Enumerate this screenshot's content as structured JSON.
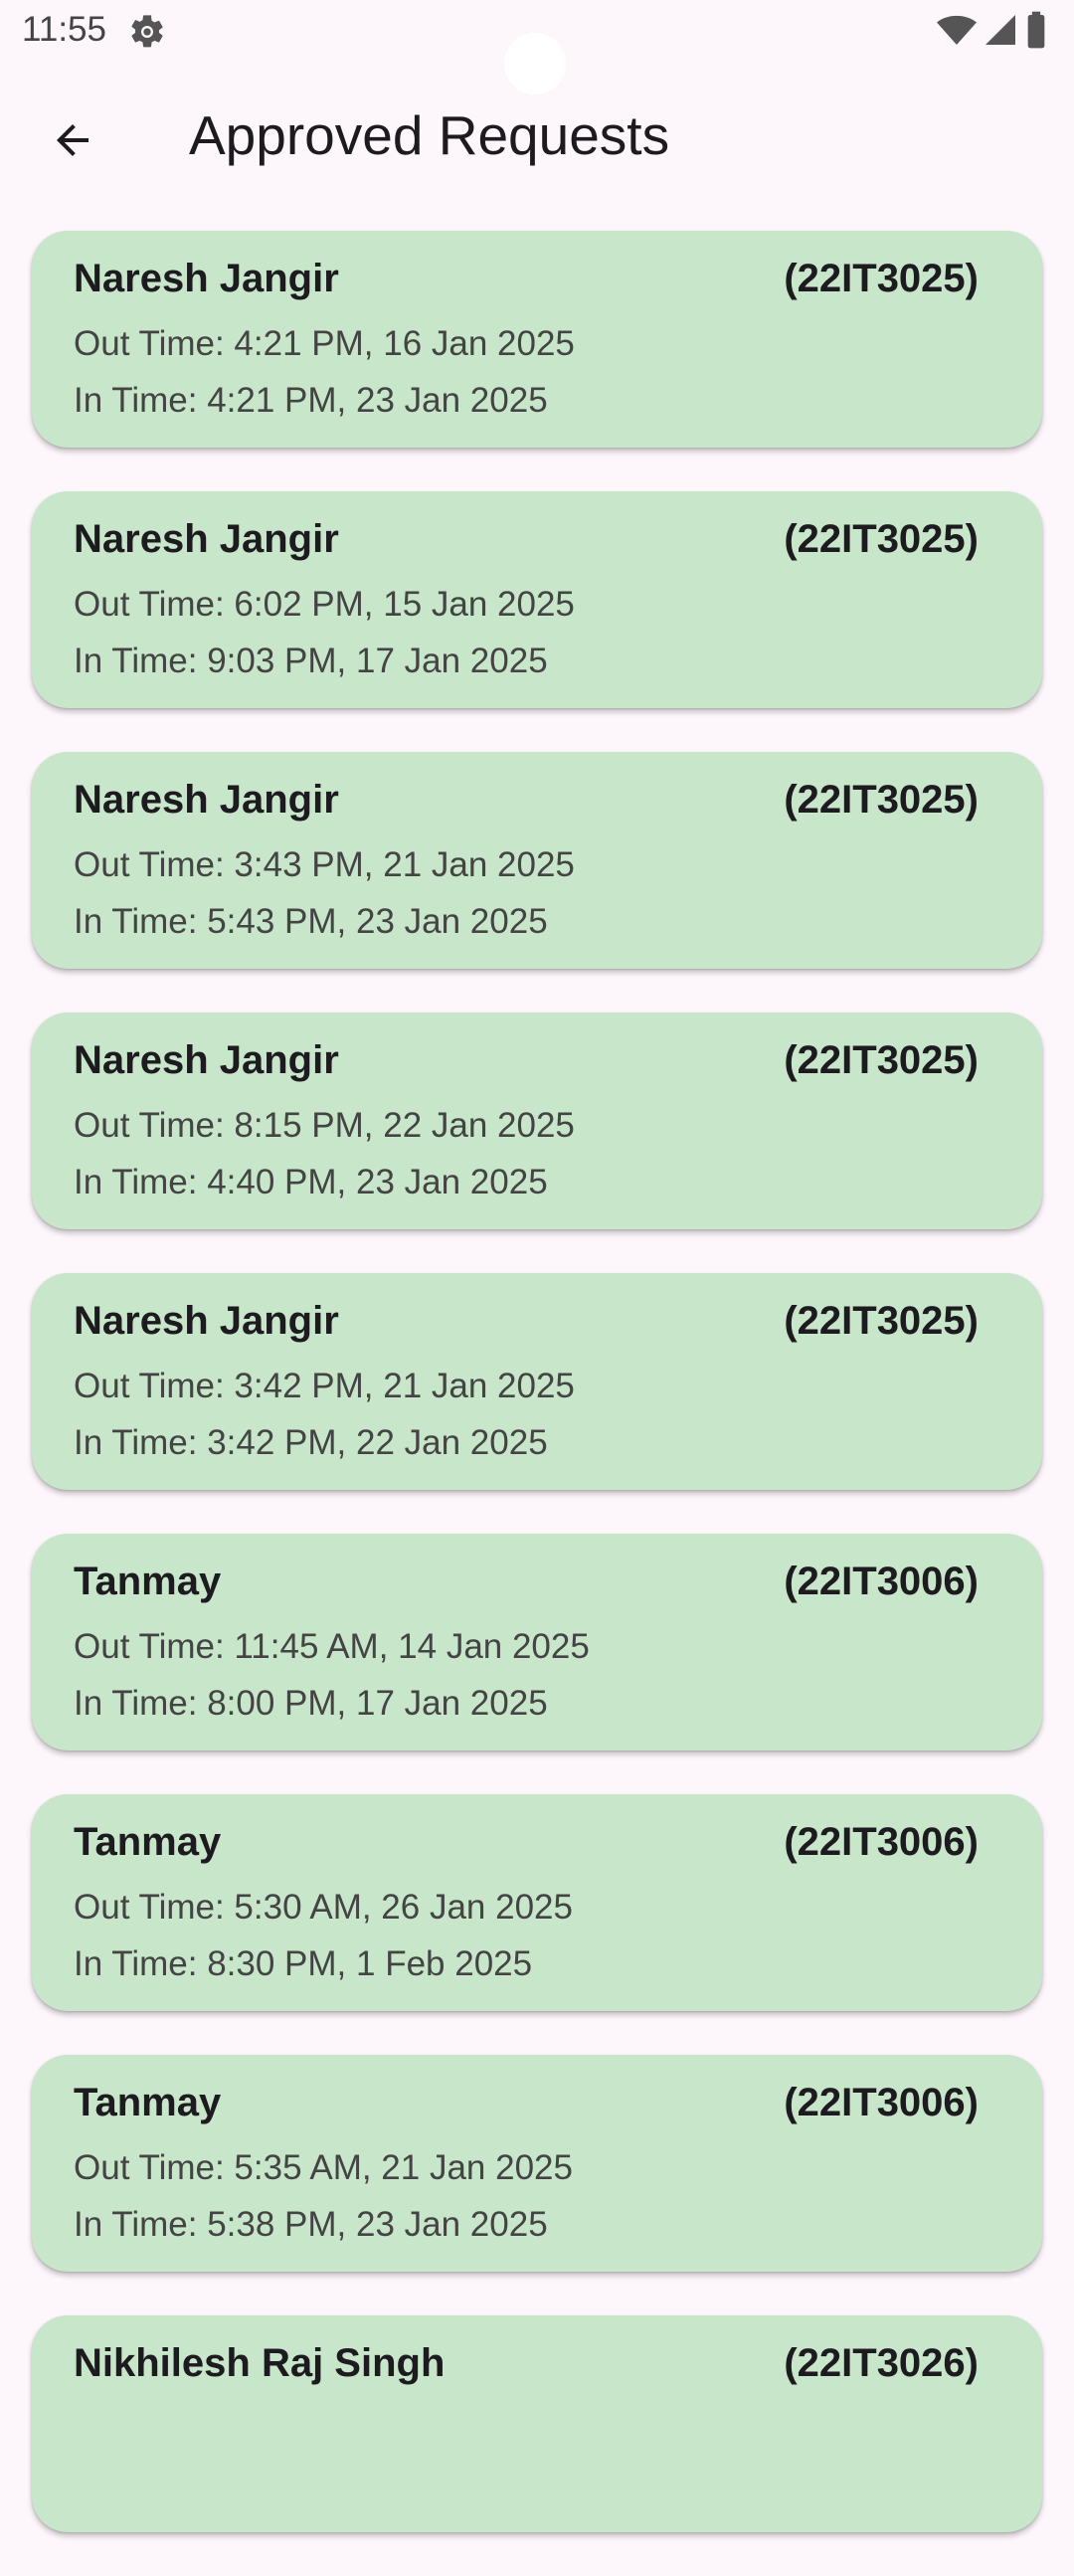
{
  "status_bar": {
    "time": "11:55",
    "icons": [
      "settings-gear-icon",
      "wifi-icon",
      "cellular-signal-icon",
      "battery-icon"
    ]
  },
  "app_bar": {
    "back_icon": "arrow-back-icon",
    "title": "Approved Requests"
  },
  "requests": [
    {
      "name": "Naresh Jangir",
      "id": "(22IT3025)",
      "out": "Out Time: 4:21 PM, 16 Jan 2025",
      "in": "In Time: 4:21 PM, 23 Jan 2025"
    },
    {
      "name": "Naresh Jangir",
      "id": "(22IT3025)",
      "out": "Out Time: 6:02 PM, 15 Jan 2025",
      "in": "In Time: 9:03 PM, 17 Jan 2025"
    },
    {
      "name": "Naresh Jangir",
      "id": "(22IT3025)",
      "out": "Out Time: 3:43 PM, 21 Jan 2025",
      "in": "In Time: 5:43 PM, 23 Jan 2025"
    },
    {
      "name": "Naresh Jangir",
      "id": "(22IT3025)",
      "out": "Out Time: 8:15 PM, 22 Jan 2025",
      "in": "In Time: 4:40 PM, 23 Jan 2025"
    },
    {
      "name": "Naresh Jangir",
      "id": "(22IT3025)",
      "out": "Out Time: 3:42 PM, 21 Jan 2025",
      "in": "In Time: 3:42 PM, 22 Jan 2025"
    },
    {
      "name": "Tanmay",
      "id": "(22IT3006)",
      "out": "Out Time: 11:45 AM, 14 Jan 2025",
      "in": "In Time: 8:00 PM, 17 Jan 2025"
    },
    {
      "name": "Tanmay",
      "id": "(22IT3006)",
      "out": "Out Time: 5:30 AM, 26 Jan 2025",
      "in": "In Time: 8:30 PM, 1 Feb 2025"
    },
    {
      "name": "Tanmay",
      "id": "(22IT3006)",
      "out": "Out Time: 5:35 AM, 21 Jan 2025",
      "in": "In Time: 5:38 PM, 23 Jan 2025"
    },
    {
      "name": "Nikhilesh Raj Singh",
      "id": "(22IT3026)",
      "out": "",
      "in": ""
    }
  ],
  "colors": {
    "background": "#fdf7fc",
    "card": "#c8e6c9",
    "title_text": "#1d1b20",
    "secondary_text": "#444444"
  }
}
